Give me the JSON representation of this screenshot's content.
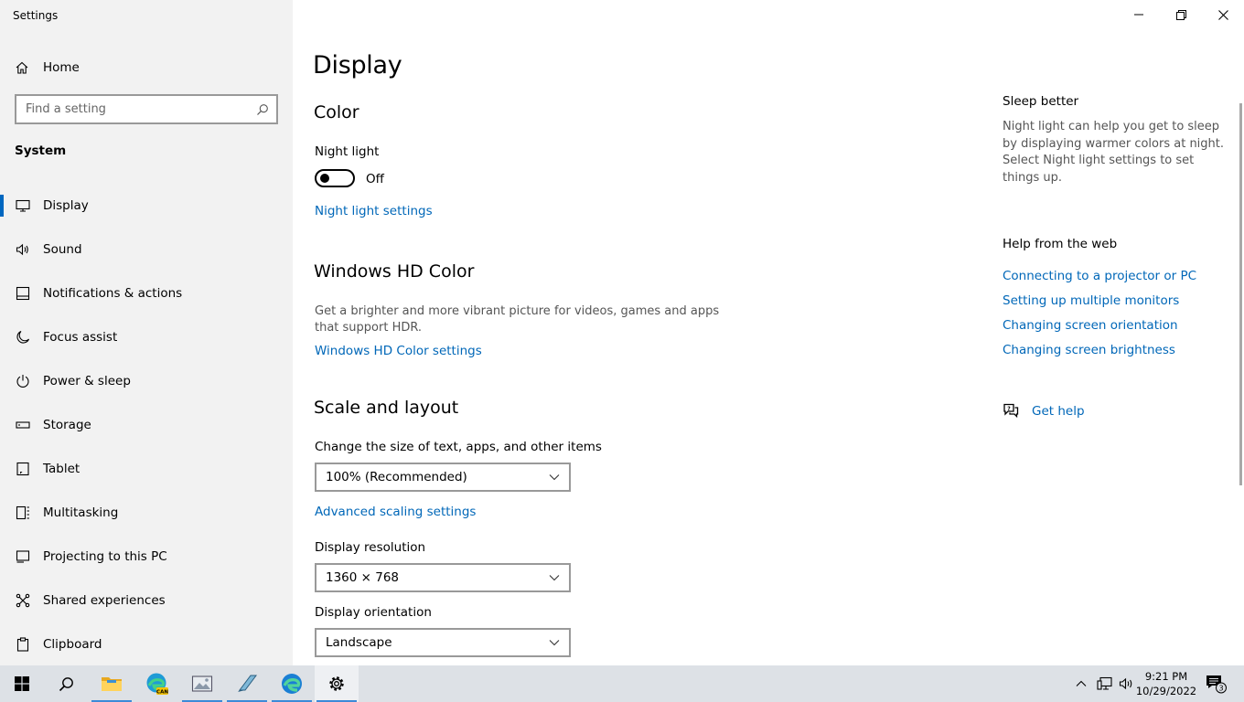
{
  "window": {
    "title": "Settings",
    "controls": {
      "minimize": "minimize-icon",
      "restore": "restore-icon",
      "close": "close-icon"
    }
  },
  "sidebar": {
    "home_label": "Home",
    "search_placeholder": "Find a setting",
    "section_title": "System",
    "items": [
      {
        "label": "Display",
        "icon": "monitor-icon",
        "active": true
      },
      {
        "label": "Sound",
        "icon": "speaker-icon"
      },
      {
        "label": "Notifications & actions",
        "icon": "notification-icon"
      },
      {
        "label": "Focus assist",
        "icon": "moon-icon"
      },
      {
        "label": "Power & sleep",
        "icon": "power-icon"
      },
      {
        "label": "Storage",
        "icon": "storage-icon"
      },
      {
        "label": "Tablet",
        "icon": "tablet-icon"
      },
      {
        "label": "Multitasking",
        "icon": "multitasking-icon"
      },
      {
        "label": "Projecting to this PC",
        "icon": "projecting-icon"
      },
      {
        "label": "Shared experiences",
        "icon": "shared-experiences-icon"
      },
      {
        "label": "Clipboard",
        "icon": "clipboard-icon"
      }
    ]
  },
  "main": {
    "page_title": "Display",
    "color": {
      "title": "Color",
      "night_light_label": "Night light",
      "night_light_state": "Off",
      "night_light_on": false,
      "night_light_settings_link": "Night light settings"
    },
    "hd_color": {
      "title": "Windows HD Color",
      "description": "Get a brighter and more vibrant picture for videos, games and apps that support HDR.",
      "settings_link": "Windows HD Color settings"
    },
    "scale_layout": {
      "title": "Scale and layout",
      "size_label": "Change the size of text, apps, and other items",
      "size_value": "100% (Recommended)",
      "advanced_link": "Advanced scaling settings",
      "resolution_label": "Display resolution",
      "resolution_value": "1360 × 768",
      "orientation_label": "Display orientation",
      "orientation_value": "Landscape"
    }
  },
  "rail": {
    "sleep_title": "Sleep better",
    "sleep_desc": "Night light can help you get to sleep by displaying warmer colors at night. Select Night light settings to set things up.",
    "help_title": "Help from the web",
    "help_links": [
      "Connecting to a projector or PC",
      "Setting up multiple monitors",
      "Changing screen orientation",
      "Changing screen brightness"
    ],
    "get_help": "Get help"
  },
  "taskbar": {
    "time": "9:21 PM",
    "date": "10/29/2022",
    "notification_count": "3",
    "apps": [
      "start-icon",
      "search-icon",
      "file-explorer-icon",
      "edge-can-icon",
      "photos-icon",
      "notepad-icon",
      "edge-icon",
      "settings-icon"
    ]
  },
  "colors": {
    "accent": "#0067c0",
    "link": "#0067b8",
    "sidebar_bg": "#f2f2f2",
    "taskbar_bg": "#dde1e6"
  }
}
